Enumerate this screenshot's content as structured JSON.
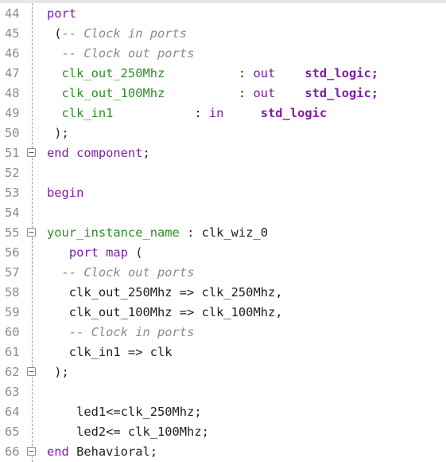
{
  "editor": {
    "lines": [
      {
        "num": "44",
        "segments": [
          {
            "t": "port",
            "c": "kw"
          }
        ]
      },
      {
        "num": "45",
        "segments": [
          {
            "t": " (",
            "c": "tx"
          },
          {
            "t": "-- Clock in ports",
            "c": "cm"
          }
        ]
      },
      {
        "num": "46",
        "segments": [
          {
            "t": "  ",
            "c": "tx"
          },
          {
            "t": "-- Clock out ports",
            "c": "cm"
          }
        ]
      },
      {
        "num": "47",
        "segments": [
          {
            "t": "  clk_out_250Mhz",
            "c": "id"
          },
          {
            "t": "          : ",
            "c": "tx"
          },
          {
            "t": "out",
            "c": "kw"
          },
          {
            "t": "    ",
            "c": "tx"
          },
          {
            "t": "std_logic;",
            "c": "kwb"
          }
        ]
      },
      {
        "num": "48",
        "segments": [
          {
            "t": "  clk_out_100Mhz",
            "c": "id"
          },
          {
            "t": "          : ",
            "c": "tx"
          },
          {
            "t": "out",
            "c": "kw"
          },
          {
            "t": "    ",
            "c": "tx"
          },
          {
            "t": "std_logic;",
            "c": "kwb"
          }
        ]
      },
      {
        "num": "49",
        "segments": [
          {
            "t": "  clk_in1",
            "c": "id"
          },
          {
            "t": "           : ",
            "c": "tx"
          },
          {
            "t": "in",
            "c": "kw"
          },
          {
            "t": "     ",
            "c": "tx"
          },
          {
            "t": "std_logic",
            "c": "kwb"
          }
        ]
      },
      {
        "num": "50",
        "segments": [
          {
            "t": " );",
            "c": "tx"
          }
        ]
      },
      {
        "num": "51",
        "segments": [
          {
            "t": "end component",
            "c": "kw"
          },
          {
            "t": ";",
            "c": "tx"
          }
        ]
      },
      {
        "num": "52",
        "segments": []
      },
      {
        "num": "53",
        "segments": [
          {
            "t": "begin",
            "c": "kw"
          }
        ]
      },
      {
        "num": "54",
        "segments": []
      },
      {
        "num": "55",
        "segments": [
          {
            "t": "your_instance_name",
            "c": "id"
          },
          {
            "t": " : clk_wiz_0",
            "c": "tx"
          }
        ]
      },
      {
        "num": "56",
        "segments": [
          {
            "t": "   ",
            "c": "tx"
          },
          {
            "t": "port map",
            "c": "kw"
          },
          {
            "t": " (",
            "c": "tx"
          }
        ]
      },
      {
        "num": "57",
        "segments": [
          {
            "t": "  ",
            "c": "tx"
          },
          {
            "t": "-- Clock out ports",
            "c": "cm"
          }
        ]
      },
      {
        "num": "58",
        "segments": [
          {
            "t": "   clk_out_250Mhz => clk_250Mhz,",
            "c": "tx"
          }
        ]
      },
      {
        "num": "59",
        "segments": [
          {
            "t": "   clk_out_100Mhz => clk_100Mhz,",
            "c": "tx"
          }
        ]
      },
      {
        "num": "60",
        "segments": [
          {
            "t": "   ",
            "c": "tx"
          },
          {
            "t": "-- Clock in ports",
            "c": "cm"
          }
        ]
      },
      {
        "num": "61",
        "segments": [
          {
            "t": "   clk_in1 => clk",
            "c": "tx"
          }
        ]
      },
      {
        "num": "62",
        "segments": [
          {
            "t": " );",
            "c": "tx"
          }
        ]
      },
      {
        "num": "63",
        "segments": []
      },
      {
        "num": "64",
        "segments": [
          {
            "t": "    led1<=clk_250Mhz;",
            "c": "tx"
          }
        ]
      },
      {
        "num": "65",
        "segments": [
          {
            "t": "    led2<= clk_100Mhz;",
            "c": "tx"
          }
        ]
      },
      {
        "num": "66",
        "segments": [
          {
            "t": "end",
            "c": "kw"
          },
          {
            "t": " Behavioral;",
            "c": "tx"
          }
        ]
      }
    ],
    "fold_markers": [
      "51",
      "55",
      "62",
      "66"
    ],
    "colors": {
      "keyword": "#7b1fa2",
      "comment": "#8a8a8a",
      "identifier": "#2e8b28",
      "text": "#1f1f1f",
      "line_number": "#8c8c8c"
    }
  }
}
